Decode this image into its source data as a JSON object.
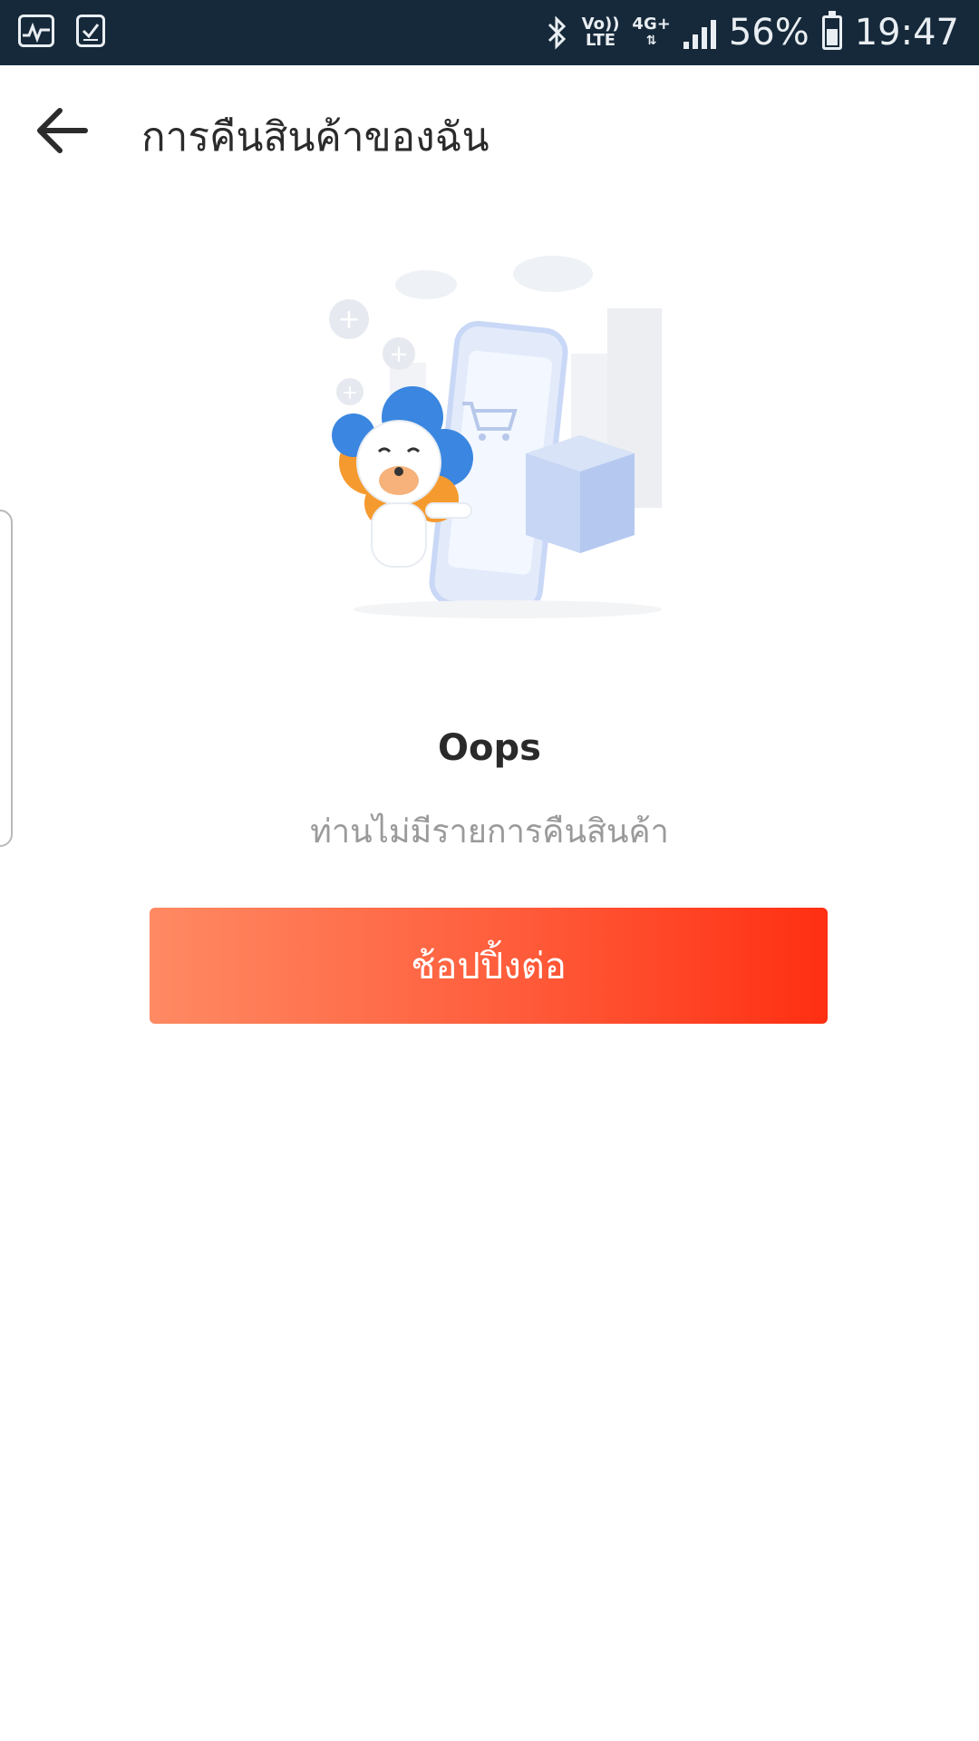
{
  "status_bar": {
    "network_top": "Vo))",
    "network_bottom": "LTE",
    "data_type": "4G+",
    "battery": "56%",
    "time": "19:47",
    "icons": [
      "activity-icon",
      "task-check-icon",
      "bluetooth-icon",
      "signal-icon",
      "battery-icon"
    ]
  },
  "header": {
    "title": "การคืนสินค้าของฉัน",
    "back_icon": "arrow-left-icon"
  },
  "empty_state": {
    "illustration": "lion-mascot-phone-cart-illustration",
    "title": "Oops",
    "message": "ท่านไม่มีรายการคืนสินค้า",
    "button_label": "ช้อปปิ้งต่อ"
  },
  "colors": {
    "status_bar_bg": "#16293a",
    "button_gradient_start": "#ff8a63",
    "button_gradient_end": "#ff2f12",
    "title_text": "#2a2a2a",
    "message_text": "#9a9a9a"
  }
}
